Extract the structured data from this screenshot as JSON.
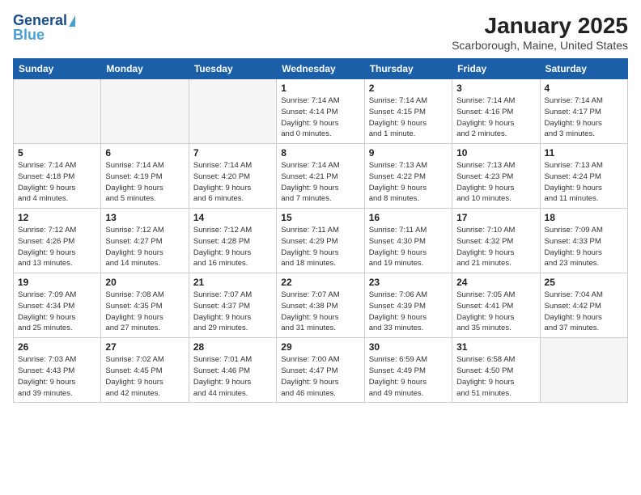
{
  "header": {
    "logo_line1": "General",
    "logo_line2": "Blue",
    "title": "January 2025",
    "location": "Scarborough, Maine, United States"
  },
  "weekdays": [
    "Sunday",
    "Monday",
    "Tuesday",
    "Wednesday",
    "Thursday",
    "Friday",
    "Saturday"
  ],
  "weeks": [
    [
      {
        "day": "",
        "info": ""
      },
      {
        "day": "",
        "info": ""
      },
      {
        "day": "",
        "info": ""
      },
      {
        "day": "1",
        "info": "Sunrise: 7:14 AM\nSunset: 4:14 PM\nDaylight: 9 hours\nand 0 minutes."
      },
      {
        "day": "2",
        "info": "Sunrise: 7:14 AM\nSunset: 4:15 PM\nDaylight: 9 hours\nand 1 minute."
      },
      {
        "day": "3",
        "info": "Sunrise: 7:14 AM\nSunset: 4:16 PM\nDaylight: 9 hours\nand 2 minutes."
      },
      {
        "day": "4",
        "info": "Sunrise: 7:14 AM\nSunset: 4:17 PM\nDaylight: 9 hours\nand 3 minutes."
      }
    ],
    [
      {
        "day": "5",
        "info": "Sunrise: 7:14 AM\nSunset: 4:18 PM\nDaylight: 9 hours\nand 4 minutes."
      },
      {
        "day": "6",
        "info": "Sunrise: 7:14 AM\nSunset: 4:19 PM\nDaylight: 9 hours\nand 5 minutes."
      },
      {
        "day": "7",
        "info": "Sunrise: 7:14 AM\nSunset: 4:20 PM\nDaylight: 9 hours\nand 6 minutes."
      },
      {
        "day": "8",
        "info": "Sunrise: 7:14 AM\nSunset: 4:21 PM\nDaylight: 9 hours\nand 7 minutes."
      },
      {
        "day": "9",
        "info": "Sunrise: 7:13 AM\nSunset: 4:22 PM\nDaylight: 9 hours\nand 8 minutes."
      },
      {
        "day": "10",
        "info": "Sunrise: 7:13 AM\nSunset: 4:23 PM\nDaylight: 9 hours\nand 10 minutes."
      },
      {
        "day": "11",
        "info": "Sunrise: 7:13 AM\nSunset: 4:24 PM\nDaylight: 9 hours\nand 11 minutes."
      }
    ],
    [
      {
        "day": "12",
        "info": "Sunrise: 7:12 AM\nSunset: 4:26 PM\nDaylight: 9 hours\nand 13 minutes."
      },
      {
        "day": "13",
        "info": "Sunrise: 7:12 AM\nSunset: 4:27 PM\nDaylight: 9 hours\nand 14 minutes."
      },
      {
        "day": "14",
        "info": "Sunrise: 7:12 AM\nSunset: 4:28 PM\nDaylight: 9 hours\nand 16 minutes."
      },
      {
        "day": "15",
        "info": "Sunrise: 7:11 AM\nSunset: 4:29 PM\nDaylight: 9 hours\nand 18 minutes."
      },
      {
        "day": "16",
        "info": "Sunrise: 7:11 AM\nSunset: 4:30 PM\nDaylight: 9 hours\nand 19 minutes."
      },
      {
        "day": "17",
        "info": "Sunrise: 7:10 AM\nSunset: 4:32 PM\nDaylight: 9 hours\nand 21 minutes."
      },
      {
        "day": "18",
        "info": "Sunrise: 7:09 AM\nSunset: 4:33 PM\nDaylight: 9 hours\nand 23 minutes."
      }
    ],
    [
      {
        "day": "19",
        "info": "Sunrise: 7:09 AM\nSunset: 4:34 PM\nDaylight: 9 hours\nand 25 minutes."
      },
      {
        "day": "20",
        "info": "Sunrise: 7:08 AM\nSunset: 4:35 PM\nDaylight: 9 hours\nand 27 minutes."
      },
      {
        "day": "21",
        "info": "Sunrise: 7:07 AM\nSunset: 4:37 PM\nDaylight: 9 hours\nand 29 minutes."
      },
      {
        "day": "22",
        "info": "Sunrise: 7:07 AM\nSunset: 4:38 PM\nDaylight: 9 hours\nand 31 minutes."
      },
      {
        "day": "23",
        "info": "Sunrise: 7:06 AM\nSunset: 4:39 PM\nDaylight: 9 hours\nand 33 minutes."
      },
      {
        "day": "24",
        "info": "Sunrise: 7:05 AM\nSunset: 4:41 PM\nDaylight: 9 hours\nand 35 minutes."
      },
      {
        "day": "25",
        "info": "Sunrise: 7:04 AM\nSunset: 4:42 PM\nDaylight: 9 hours\nand 37 minutes."
      }
    ],
    [
      {
        "day": "26",
        "info": "Sunrise: 7:03 AM\nSunset: 4:43 PM\nDaylight: 9 hours\nand 39 minutes."
      },
      {
        "day": "27",
        "info": "Sunrise: 7:02 AM\nSunset: 4:45 PM\nDaylight: 9 hours\nand 42 minutes."
      },
      {
        "day": "28",
        "info": "Sunrise: 7:01 AM\nSunset: 4:46 PM\nDaylight: 9 hours\nand 44 minutes."
      },
      {
        "day": "29",
        "info": "Sunrise: 7:00 AM\nSunset: 4:47 PM\nDaylight: 9 hours\nand 46 minutes."
      },
      {
        "day": "30",
        "info": "Sunrise: 6:59 AM\nSunset: 4:49 PM\nDaylight: 9 hours\nand 49 minutes."
      },
      {
        "day": "31",
        "info": "Sunrise: 6:58 AM\nSunset: 4:50 PM\nDaylight: 9 hours\nand 51 minutes."
      },
      {
        "day": "",
        "info": ""
      }
    ]
  ]
}
